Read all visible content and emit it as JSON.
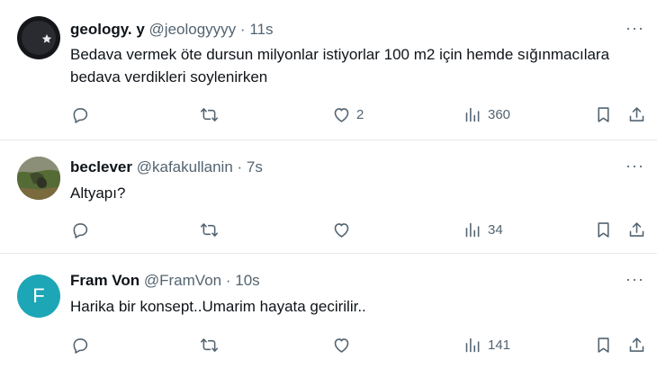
{
  "tweets": [
    {
      "name": "geology. y",
      "handle": "@jeologyyyy",
      "separator": "·",
      "time": "11s",
      "text": "Bedava vermek öte dursun milyonlar istiyorlar 100 m2 için hemde sığınmacılara bedava verdikleri soylenirken",
      "likes": "2",
      "views": "360",
      "avatar": "flag-avatar"
    },
    {
      "name": "beclever",
      "handle": "@kafakullanin",
      "separator": "·",
      "time": "7s",
      "text": "Altyapı?",
      "likes": "",
      "views": "34",
      "avatar": "photo-avatar"
    },
    {
      "name": "Fram Von",
      "handle": "@FramVon",
      "separator": "·",
      "time": "10s",
      "text": "Harika bir konsept..Umarim hayata gecirilir..",
      "likes": "",
      "views": "141",
      "avatar_letter": "F"
    }
  ],
  "more_glyph": "···",
  "colors": {
    "text": "#0f1419",
    "muted": "#536471",
    "divider": "#e5e7eb",
    "avatar_teal": "#1da6b5"
  },
  "icons": [
    "reply-icon",
    "retweet-icon",
    "like-icon",
    "views-icon",
    "bookmark-icon",
    "share-icon",
    "more-icon"
  ]
}
